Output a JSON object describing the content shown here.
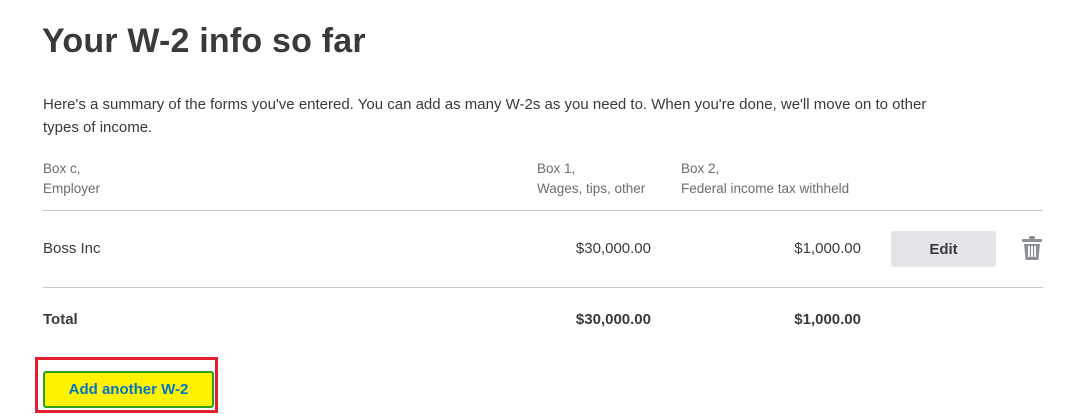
{
  "page": {
    "title": "Your W-2 info so far",
    "intro": "Here's a summary of the forms you've entered. You can add as many W-2s as you need to. When you're done, we'll move on to other types of income."
  },
  "table": {
    "headers": {
      "employer": [
        "Box c,",
        "Employer"
      ],
      "wages": [
        "Box 1,",
        "Wages, tips, other"
      ],
      "fed_tax": [
        "Box 2,",
        "Federal income tax withheld"
      ]
    },
    "rows": [
      {
        "employer": "Boss Inc",
        "wages": "$30,000.00",
        "fed_tax": "$1,000.00",
        "edit_label": "Edit",
        "delete_icon": "trash-icon"
      }
    ],
    "total": {
      "label": "Total",
      "wages": "$30,000.00",
      "fed_tax": "$1,000.00"
    }
  },
  "actions": {
    "add_label": "Add another W-2"
  },
  "colors": {
    "text": "#393a3d",
    "muted": "#6b6c72",
    "add_button_bg": "#fff200",
    "add_button_text": "#0077c5",
    "add_button_border": "#2ca01c",
    "highlight": "#e0202e",
    "edit_button_bg": "#e3e4e8"
  }
}
